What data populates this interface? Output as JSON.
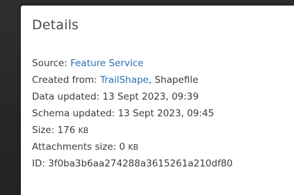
{
  "panel": {
    "title": "Details"
  },
  "details": {
    "source_label": "Source:",
    "source_value": "Feature Service",
    "created_label": "Created from:",
    "created_link": "TrailShape",
    "created_rest": ", Shapefile",
    "data_updated_label": "Data updated:",
    "data_updated_value": "13 Sept 2023, 09:39",
    "schema_updated_label": "Schema updated:",
    "schema_updated_value": "13 Sept 2023, 09:45",
    "size_label": "Size:",
    "size_value": "176",
    "size_unit": "KB",
    "attachments_label": "Attachments size:",
    "attachments_value": "0",
    "attachments_unit": "KB",
    "id_label": "ID:",
    "id_value": "3f0ba3b6aa274288a3615261a210df80"
  },
  "colors": {
    "link": "#2a6fb5",
    "text": "#3c3c3c",
    "background": "#2a2a2a",
    "card": "#ffffff"
  }
}
